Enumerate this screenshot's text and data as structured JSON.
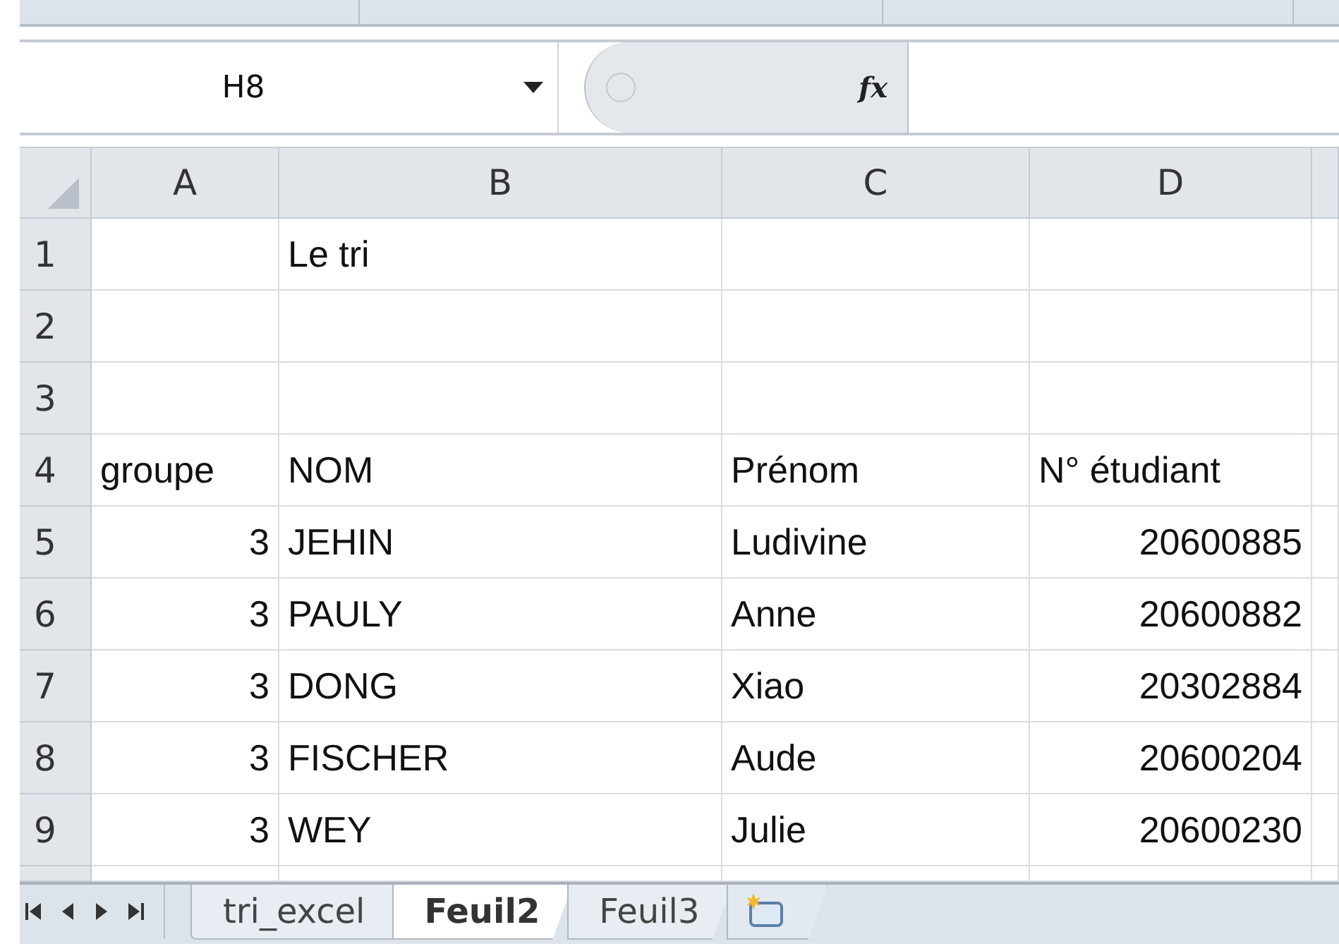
{
  "formula_bar": {
    "name_box": "H8",
    "function_button": "fx"
  },
  "sheet": {
    "columns": [
      "A",
      "B",
      "C",
      "D"
    ],
    "rows": [
      {
        "number": "1",
        "cells": [
          null,
          {
            "text": "Le tri",
            "right_aligned": false
          },
          null,
          null
        ]
      },
      {
        "number": "2",
        "cells": [
          null,
          null,
          null,
          null
        ]
      },
      {
        "number": "3",
        "cells": [
          null,
          null,
          null,
          null
        ]
      },
      {
        "number": "4",
        "cells": [
          {
            "text": "groupe",
            "right_aligned": false
          },
          {
            "text": "NOM",
            "right_aligned": false
          },
          {
            "text": "Prénom",
            "right_aligned": false
          },
          {
            "text": "N° étudiant",
            "right_aligned": false
          }
        ]
      },
      {
        "number": "5",
        "cells": [
          {
            "text": "3",
            "right_aligned": true
          },
          {
            "text": "JEHIN",
            "right_aligned": false
          },
          {
            "text": "Ludivine",
            "right_aligned": false
          },
          {
            "text": "20600885",
            "right_aligned": true
          }
        ]
      },
      {
        "number": "6",
        "cells": [
          {
            "text": "3",
            "right_aligned": true
          },
          {
            "text": "PAULY",
            "right_aligned": false
          },
          {
            "text": "Anne",
            "right_aligned": false
          },
          {
            "text": "20600882",
            "right_aligned": true
          }
        ]
      },
      {
        "number": "7",
        "cells": [
          {
            "text": "3",
            "right_aligned": true
          },
          {
            "text": "DONG",
            "right_aligned": false
          },
          {
            "text": "Xiao",
            "right_aligned": false
          },
          {
            "text": "20302884",
            "right_aligned": true
          }
        ]
      },
      {
        "number": "8",
        "cells": [
          {
            "text": "3",
            "right_aligned": true
          },
          {
            "text": "FISCHER",
            "right_aligned": false
          },
          {
            "text": "Aude",
            "right_aligned": false
          },
          {
            "text": "20600204",
            "right_aligned": true
          }
        ]
      },
      {
        "number": "9",
        "cells": [
          {
            "text": "3",
            "right_aligned": true
          },
          {
            "text": "WEY",
            "right_aligned": false
          },
          {
            "text": "Julie",
            "right_aligned": false
          },
          {
            "text": "20600230",
            "right_aligned": true
          }
        ]
      }
    ]
  },
  "sheet_tabs": [
    {
      "label": "tri_excel",
      "selected": false
    },
    {
      "label": "Feuil2",
      "selected": true
    },
    {
      "label": "Feuil3",
      "selected": false
    }
  ]
}
